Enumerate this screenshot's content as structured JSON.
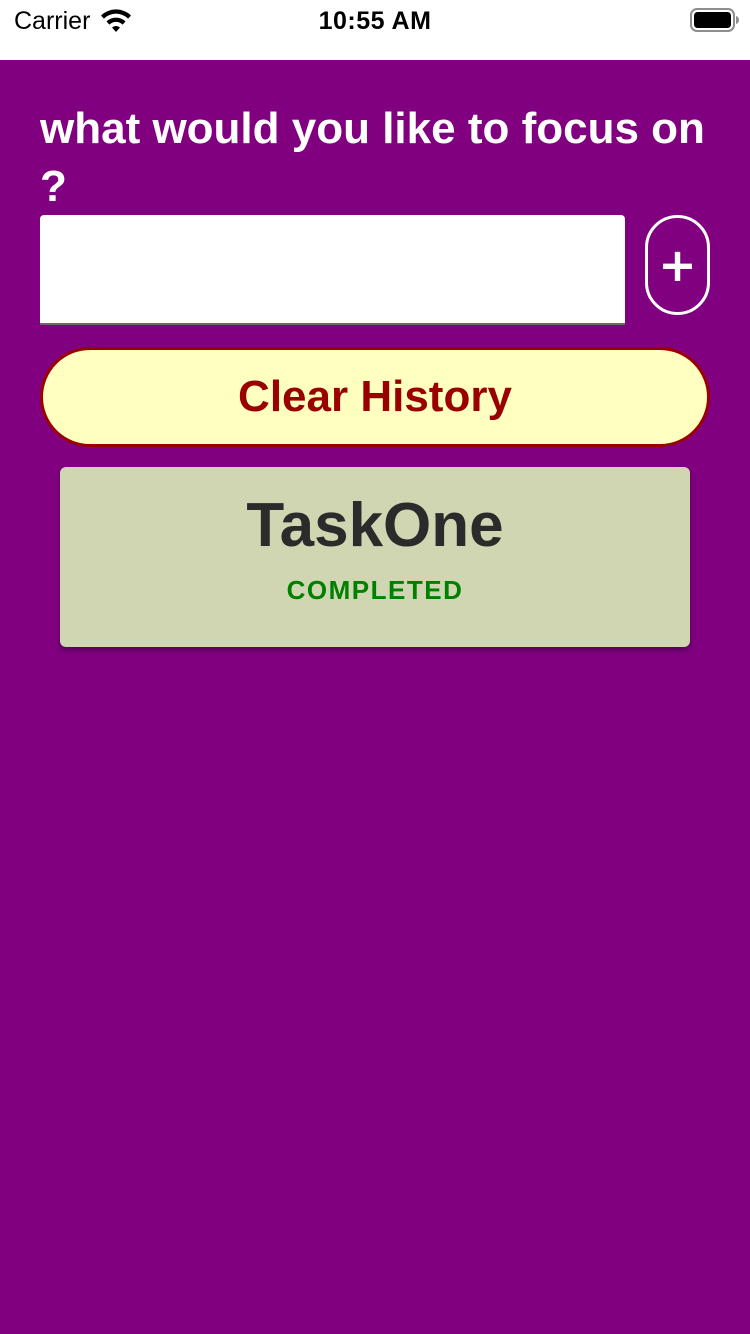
{
  "status_bar": {
    "carrier": "Carrier",
    "time": "10:55 AM",
    "icons": [
      "wifi-icon",
      "battery-icon"
    ]
  },
  "main": {
    "prompt": "what would you like to focus on ?",
    "task_input": {
      "value": "",
      "placeholder": ""
    },
    "add_button_icon": "+",
    "clear_history_label": "Clear History"
  },
  "tasks": [
    {
      "title": "TaskOne",
      "status": "COMPLETED"
    }
  ],
  "colors": {
    "background": "#800080",
    "clear_button_bg": "#ffffc0",
    "clear_button_text": "#9b0000",
    "card_bg": "#cfd6b1",
    "status_completed": "#008000"
  }
}
